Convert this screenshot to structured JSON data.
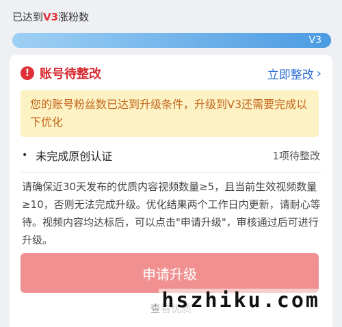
{
  "top": {
    "reached_prefix": "已达到",
    "reached_level": "V3",
    "reached_suffix": "涨粉数",
    "progress_end_label": "V3",
    "progress_fraction": 1.0
  },
  "card": {
    "title": "账号待整改",
    "fix_link": "立即整改",
    "notice": "您的账号粉丝数已达到升级条件，升级到V3还需要完成以下优化",
    "task": {
      "bullet": "•",
      "label": "未完成原创认证",
      "status": "1项待整改"
    },
    "description": "请确保近30天发布的优质内容视频数量≥5，且当前生效视频数量≥10，否则无法完成升级。优化结果两个工作日内更新，请耐心等待。视频内容均达标后，可以点击\"申请升级\"，审核通过后可进行升级。",
    "apply_button": "申请升级",
    "footer_link": "查看优质"
  },
  "watermark": "hszhiku.com",
  "colors": {
    "accent_red": "#d7282f",
    "link_blue": "#2f6fd6",
    "notice_bg": "#fdf2c4",
    "notice_text": "#c2651b",
    "button_bg": "#f09090"
  }
}
